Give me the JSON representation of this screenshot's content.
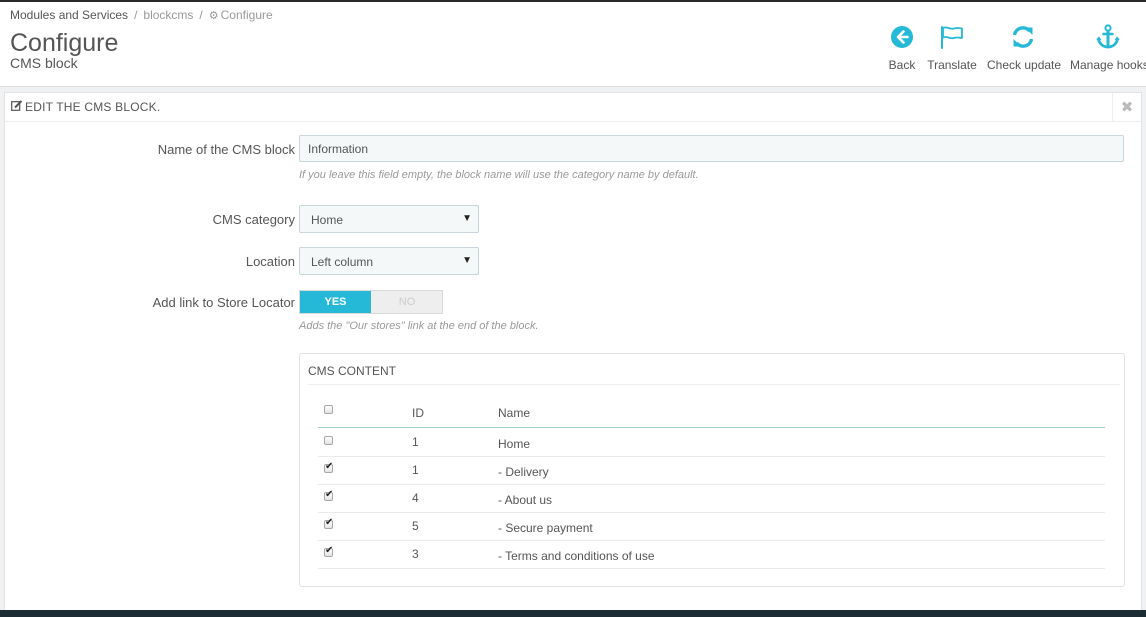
{
  "breadcrumb": {
    "items": [
      "Modules and Services",
      "blockcms",
      "Configure"
    ],
    "separator": "/"
  },
  "page": {
    "title": "Configure",
    "subtitle": "CMS block"
  },
  "toolbar": {
    "buttons": [
      {
        "label": "Back",
        "icon": "back-arrow-circle-icon"
      },
      {
        "label": "Translate",
        "icon": "flag-icon"
      },
      {
        "label": "Check update",
        "icon": "refresh-icon"
      },
      {
        "label": "Manage hooks",
        "icon": "anchor-icon"
      }
    ],
    "icon_color": "#25b9d7"
  },
  "panel": {
    "heading": "EDIT THE CMS BLOCK.",
    "close_icon": "close-icon"
  },
  "form": {
    "name": {
      "label": "Name of the CMS block",
      "value": "Information",
      "help": "If you leave this field empty, the block name will use the category name by default."
    },
    "category": {
      "label": "CMS category",
      "value": "Home"
    },
    "location": {
      "label": "Location",
      "value": "Left column"
    },
    "store_locator": {
      "label": "Add link to Store Locator",
      "yes": "YES",
      "no": "NO",
      "selected": "YES",
      "help": "Adds the \"Our stores\" link at the end of the block."
    }
  },
  "cms_content": {
    "heading": "CMS CONTENT",
    "columns": [
      "ID",
      "Name"
    ],
    "rows": [
      {
        "checked": false,
        "id": "1",
        "name": "Home"
      },
      {
        "checked": true,
        "id": "1",
        "name": "- Delivery"
      },
      {
        "checked": true,
        "id": "4",
        "name": "- About us"
      },
      {
        "checked": true,
        "id": "5",
        "name": "- Secure payment"
      },
      {
        "checked": true,
        "id": "3",
        "name": "- Terms and conditions of use"
      }
    ]
  },
  "colors": {
    "accent": "#25b9d7",
    "background": "#eff1f2"
  }
}
